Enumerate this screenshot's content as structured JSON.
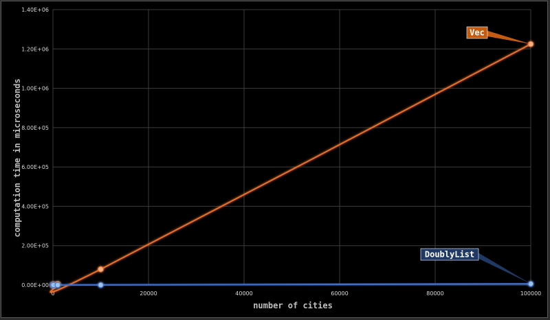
{
  "chart_data": {
    "type": "scatter",
    "xlabel": "number of cities",
    "ylabel": "computation time in microseconds",
    "xlim": [
      0,
      100000
    ],
    "ylim": [
      0,
      1400000
    ],
    "x_ticks": [
      "0",
      "20000",
      "40000",
      "60000",
      "80000",
      "100000"
    ],
    "y_ticks": [
      "0.00E+00",
      "2.00E+05",
      "4.00E+05",
      "6.00E+05",
      "8.00E+05",
      "1.00E+06",
      "1.20E+06",
      "1.40E+06"
    ],
    "grid": true,
    "series": [
      {
        "name": "Vec",
        "color": "#e86f2a",
        "x": [
          10,
          100,
          1000,
          10000,
          100000
        ],
        "y": [
          0,
          500,
          5000,
          80000,
          1225000
        ]
      },
      {
        "name": "DoublyList",
        "color": "#3f6fd1",
        "x": [
          10,
          100,
          1000,
          10000,
          100000
        ],
        "y": [
          0,
          0,
          0,
          0,
          6000
        ]
      }
    ]
  }
}
